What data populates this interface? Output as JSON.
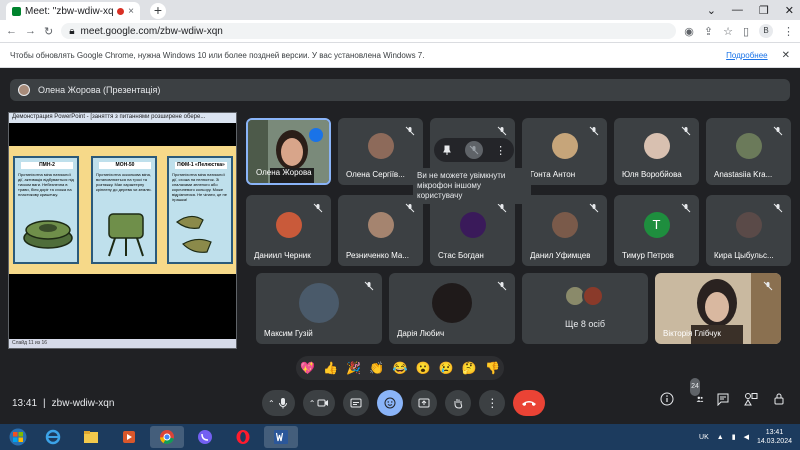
{
  "browser": {
    "tab_title": "Meet: \"zbw-wdiw-xqn\"",
    "tab_close": "×",
    "new_tab": "+",
    "url": "meet.google.com/zbw-wdiw-xqn",
    "profile_letter": "B"
  },
  "infobar": {
    "message": "Чтобы обновлять Google Chrome, нужна Windows 10 или более поздней версии. У вас установлена Windows 7.",
    "link": "Подробнее"
  },
  "meet": {
    "presenter_label": "Олена Жорова (Презентація)",
    "slide": {
      "title_bar": "Демонстрация PowerPoint - [заняття з питаннями розширене обере...",
      "status_bar": "Слайд 11 из 16",
      "panels": [
        {
          "head": "ПМН-2",
          "text": "Протипіхотна міна натискної дії, активація відбувається під тиском ваги. Небезпечна в трави, біля доріг та схожа на пластикову кришечку."
        },
        {
          "head": "МОН-50",
          "text": "Протипіхотна осколкова міна, встановлюється на тросі та розтяжку. Має характерну кріплену до дерева чи землю."
        },
        {
          "head": "ПФМ-1 «Пелюстка»",
          "text": "Протипіхотна міна натискної дії, схожа на пелюсток. Зі спалахами зеленого або коричневого кольору. Може відрізнятися. Не чіпати, це не іграшка!"
        }
      ]
    },
    "participants": [
      {
        "name": "Олена Жорова",
        "muted": false,
        "speaking": true
      },
      {
        "name": "Олена Сергіїв...",
        "muted": true
      },
      {
        "name": "",
        "muted": true
      },
      {
        "name": "Гонта Антон",
        "muted": true
      },
      {
        "name": "Юля Воробйова",
        "muted": true
      },
      {
        "name": "Anastasiia Kra...",
        "muted": true
      },
      {
        "name": "Даниил Черник",
        "muted": true
      },
      {
        "name": "Резниченко Ма...",
        "muted": true
      },
      {
        "name": "Стас Богдан",
        "muted": true
      },
      {
        "name": "Данил Уфимцев",
        "muted": true
      },
      {
        "name": "Тимур Петров",
        "muted": true,
        "letter": "Т"
      },
      {
        "name": "Кира Цыбульс...",
        "muted": true
      },
      {
        "name": "Максим Гузій",
        "muted": true
      },
      {
        "name": "Дарія Любич",
        "muted": true
      },
      {
        "name": "Ще 8 осіб",
        "muted": false
      },
      {
        "name": "Вікторія Глібчук",
        "muted": true
      }
    ],
    "tooltip": "Ви не можете увімкнути мікрофон іншому користувачу",
    "reactions": [
      "💖",
      "👍",
      "🎉",
      "👏",
      "😂",
      "😮",
      "😢",
      "🤔",
      "👎"
    ],
    "time": "13:41",
    "separator": "|",
    "meeting_code": "zbw-wdiw-xqn",
    "participant_count": "24"
  },
  "taskbar": {
    "lang": "UK",
    "time": "13:41",
    "date": "14.03.2024"
  },
  "colors": {
    "meet_bg": "#202124",
    "tile_bg": "#3c4043",
    "end_call": "#ea4335",
    "accent": "#8ab4f8",
    "taskbar": "#1c3b5e"
  }
}
